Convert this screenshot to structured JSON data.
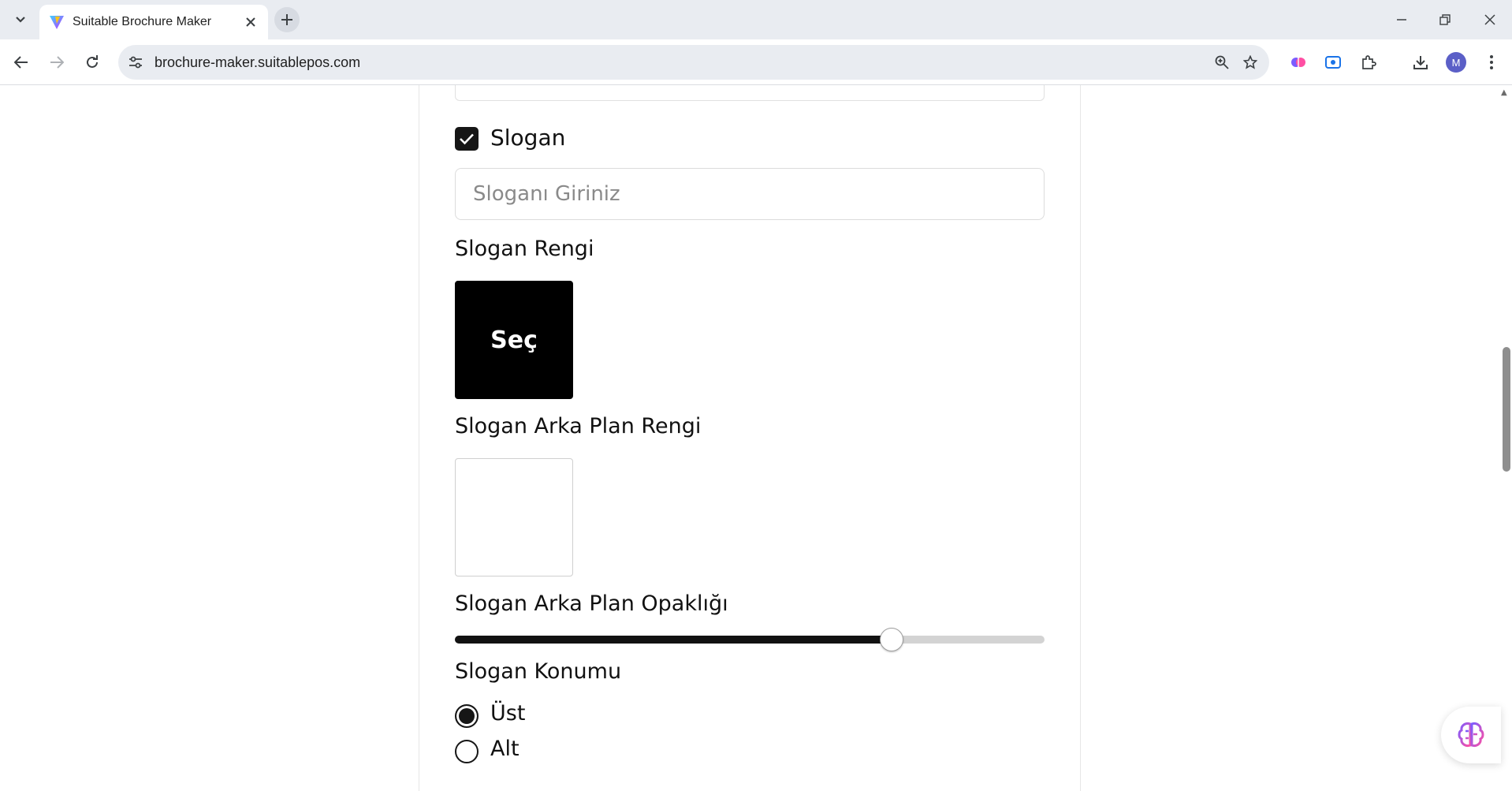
{
  "browser": {
    "tab_title": "Suitable Brochure Maker",
    "url": "brochure-maker.suitablepos.com",
    "profile_initial": "M"
  },
  "form": {
    "slogan_checkbox_label": "Slogan",
    "slogan_checked": true,
    "slogan_input_placeholder": "Sloganı Giriniz",
    "slogan_input_value": "",
    "slogan_color_label": "Slogan Rengi",
    "slogan_color_button": "Seç",
    "slogan_color": "#000000",
    "slogan_bg_color_label": "Slogan Arka Plan Rengi",
    "slogan_bg_color": "#ffffff",
    "slogan_bg_opacity_label": "Slogan Arka Plan Opaklığı",
    "slogan_bg_opacity_value": 0.74,
    "slogan_position_label": "Slogan Konumu",
    "position_options": [
      {
        "label": "Üst",
        "checked": true
      },
      {
        "label": "Alt",
        "checked": false
      }
    ]
  },
  "icons": {
    "tab_menu": "chevron-down-icon",
    "close_tab": "close-icon",
    "new_tab": "plus-icon",
    "back": "arrow-left-icon",
    "forward": "arrow-right-icon",
    "reload": "reload-icon",
    "site_info": "tune-icon",
    "zoom": "zoom-icon",
    "bookmark": "star-icon",
    "download": "download-icon",
    "menu": "kebab-menu-icon"
  }
}
